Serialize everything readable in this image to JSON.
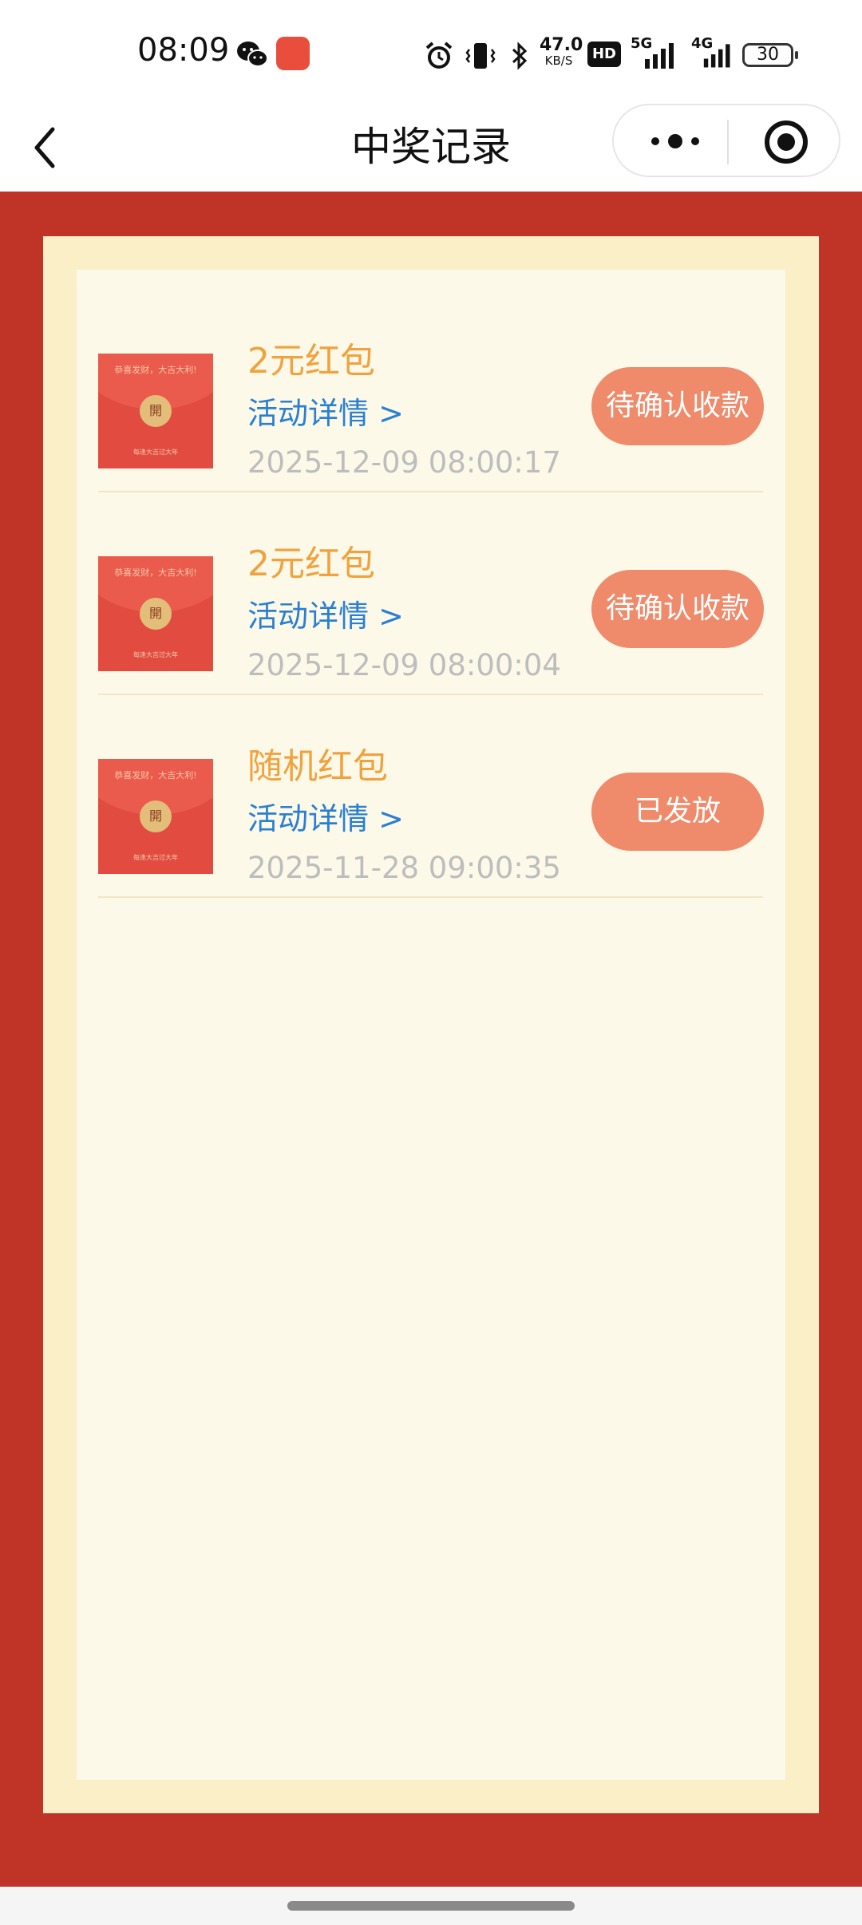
{
  "status_bar": {
    "time": "08:09",
    "net_speed_value": "47.0",
    "net_speed_unit": "KB/S",
    "hd_label": "HD",
    "net_5g": "5G",
    "net_4g": "4G",
    "battery": "30",
    "icons": [
      "wechat-icon",
      "app-icon",
      "alarm-icon",
      "vibrate-icon",
      "bluetooth-icon",
      "signal-icon",
      "battery-icon"
    ]
  },
  "nav": {
    "title": "中奖记录",
    "icons": [
      "back-icon",
      "more-icon",
      "close-target-icon"
    ]
  },
  "records": [
    {
      "title": "2元红包",
      "link": "活动详情 >",
      "time": "2025-12-09 08:00:17",
      "status": "待确认收款"
    },
    {
      "title": "2元红包",
      "link": "活动详情 >",
      "time": "2025-12-09 08:00:04",
      "status": "待确认收款"
    },
    {
      "title": "随机红包",
      "link": "活动详情 >",
      "time": "2025-11-28 09:00:35",
      "status": "已发放"
    }
  ],
  "envelope": {
    "greeting": "恭喜发财，大吉大利!",
    "seal": "開",
    "footer": "每逢大吉过大年"
  },
  "colors": {
    "background_red": "#c03427",
    "frame": "#fbefc8",
    "panel": "#fcf9e8",
    "title_orange": "#f0a23e",
    "link_blue": "#2a7fd2",
    "status_button": "#ef8a6a"
  }
}
